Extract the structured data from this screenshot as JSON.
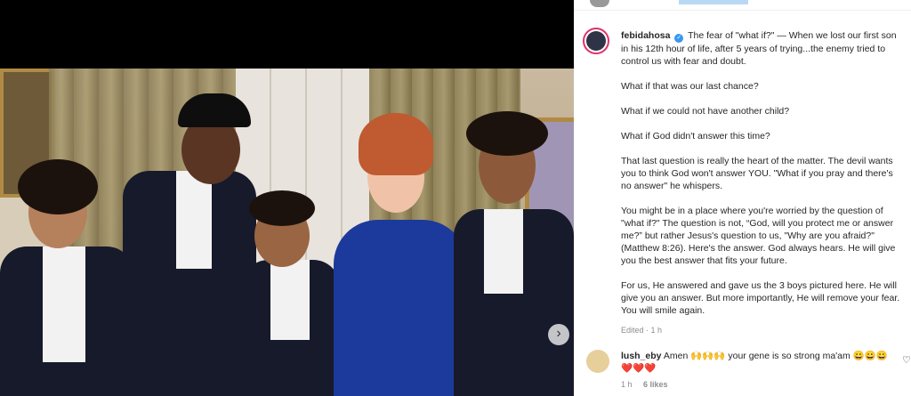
{
  "post": {
    "username": "febidahosa",
    "caption_paragraphs": [
      "The fear of \"what if?\" — When we lost our first son in his 12th hour of life, after 5 years of trying...the enemy tried to control us with fear and doubt.",
      "What if that was our last chance?",
      "What if we could not have another child?",
      "What if God didn't answer this time?",
      "That last question is really the heart of the matter. The devil wants you to think God won't answer YOU. \"What if you pray and there's no answer\" he whispers.",
      "You might be in a place where you're worried by the question of \"what if?\" The question is not, “God, will you protect me or answer me?” but rather Jesus's question to us, \"Why are you afraid?\" (Matthew 8:26). Here's the answer. God always hears. He will give you the best answer that fits your future.",
      "For us, He answered and gave us the 3 boys pictured here. He will give you an answer. But more importantly, He will remove your fear. You will smile again."
    ],
    "edited_label": "Edited · 1 h"
  },
  "comment": {
    "username": "lush_eby",
    "text": "Amen 🙌🙌🙌 your gene is so strong ma'am 😀😀😀❤️❤️❤️",
    "time": "1 h",
    "likes": "6 likes"
  },
  "icons": {
    "next": "chevron-right-icon",
    "like": "heart-icon",
    "verified": "verified-badge-icon"
  },
  "colors": {
    "verified": "#3897f0",
    "story_ring": "#e1306c",
    "text": "#262626",
    "muted": "#8e8e8e"
  }
}
